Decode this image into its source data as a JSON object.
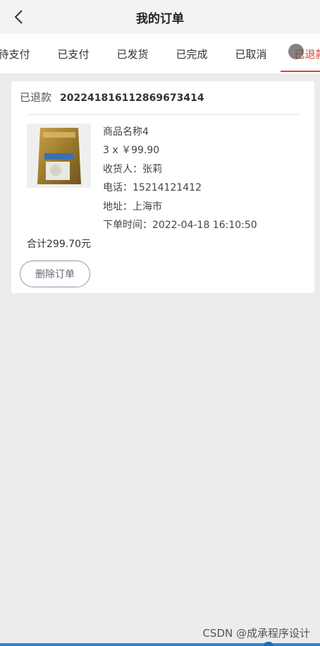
{
  "header": {
    "title": "我的订单"
  },
  "tabs": [
    {
      "label": "待支付"
    },
    {
      "label": "已支付"
    },
    {
      "label": "已发货"
    },
    {
      "label": "已完成"
    },
    {
      "label": "已取消"
    },
    {
      "label": "已退款"
    }
  ],
  "order": {
    "status": "已退款",
    "order_no": "20224181611286967341​4",
    "product_name": "商品名称4",
    "qty_price": "3 x ￥99.90",
    "receiver": "收货人：张莉",
    "phone": "电话：15214121412",
    "address": "地址：上海市",
    "order_time": "下单时间：2022-04-18 16:10:50",
    "total": "合计299.70元",
    "delete_label": "删除订单"
  },
  "watermark": "CSDN @成承程序设计",
  "colors": {
    "accent": "#d9423a",
    "background": "#ececec"
  }
}
